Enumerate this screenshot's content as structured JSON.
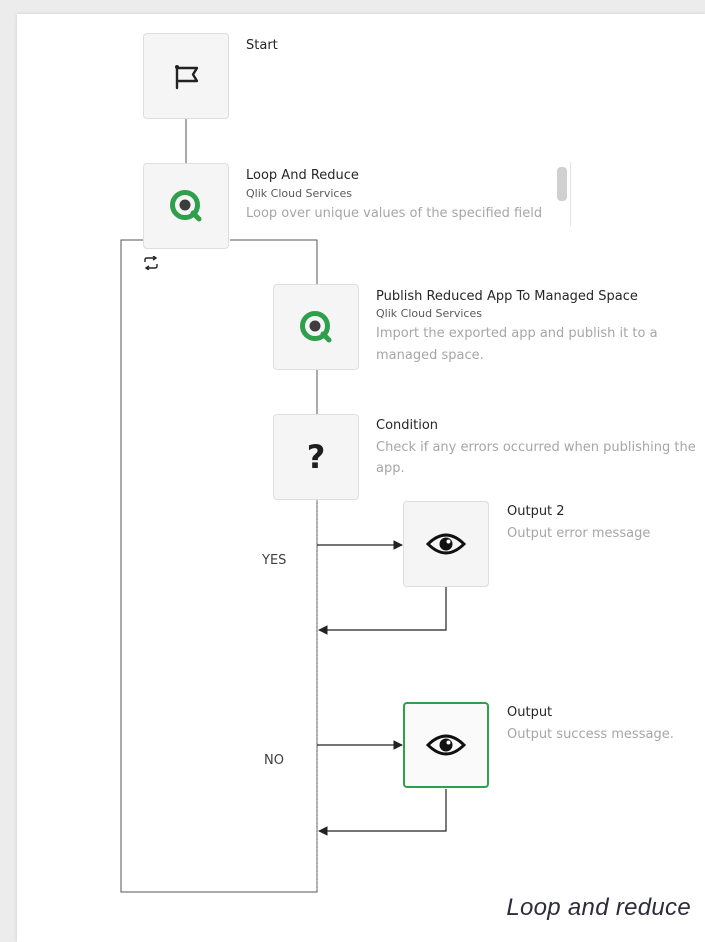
{
  "nodes": {
    "start": {
      "title": "Start",
      "icon": "flag-icon"
    },
    "loop": {
      "title": "Loop And Reduce",
      "subtitle": "Qlik Cloud Services",
      "description": "Loop over unique values of the specified field",
      "icon": "qlik-icon",
      "loop_icon": "loop-icon"
    },
    "publish": {
      "title": "Publish Reduced App To Managed Space",
      "subtitle": "Qlik Cloud Services",
      "description_line1": "Import the exported app and publish it to a",
      "description_line2": "managed space.",
      "icon": "qlik-icon"
    },
    "condition": {
      "title": "Condition",
      "description_line1": "Check if any errors occurred when publishing the",
      "description_line2": "app.",
      "icon": "question-mark-icon"
    },
    "output2": {
      "title": "Output 2",
      "description": "Output error message",
      "icon": "eye-icon"
    },
    "output": {
      "title": "Output",
      "description": "Output success message.",
      "icon": "eye-icon",
      "selected": true
    }
  },
  "branches": {
    "yes_label": "YES",
    "no_label": "NO"
  },
  "caption": "Loop and reduce",
  "colors": {
    "qlik_green": "#2e9f4a",
    "selected_border": "#2e9f4a",
    "line": "#333333"
  }
}
